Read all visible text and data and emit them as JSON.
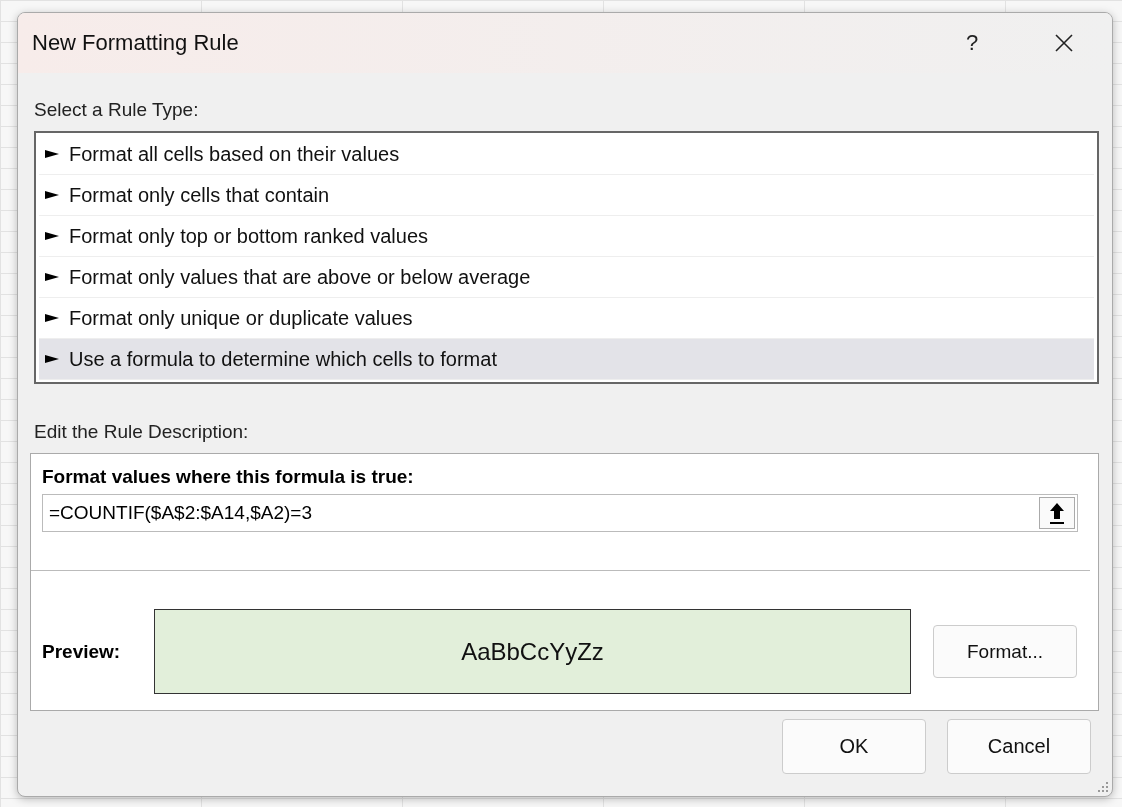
{
  "window": {
    "title": "New Formatting Rule",
    "help_button": "?"
  },
  "rule_type_label": "Select a Rule Type:",
  "rule_types": [
    {
      "label": "Format all cells based on their values",
      "selected": false
    },
    {
      "label": "Format only cells that contain",
      "selected": false
    },
    {
      "label": "Format only top or bottom ranked values",
      "selected": false
    },
    {
      "label": "Format only values that are above or below average",
      "selected": false
    },
    {
      "label": "Format only unique or duplicate values",
      "selected": false
    },
    {
      "label": "Use a formula to determine which cells to format",
      "selected": true
    }
  ],
  "description_label": "Edit the Rule Description:",
  "formula_label": "Format values where this formula is true:",
  "formula": "=COUNTIF($A$2:$A14,$A2)=3",
  "preview": {
    "label": "Preview:",
    "sample": "AaBbCcYyZz"
  },
  "format_button": "Format...",
  "buttons": [
    "OK",
    "Cancel"
  ]
}
